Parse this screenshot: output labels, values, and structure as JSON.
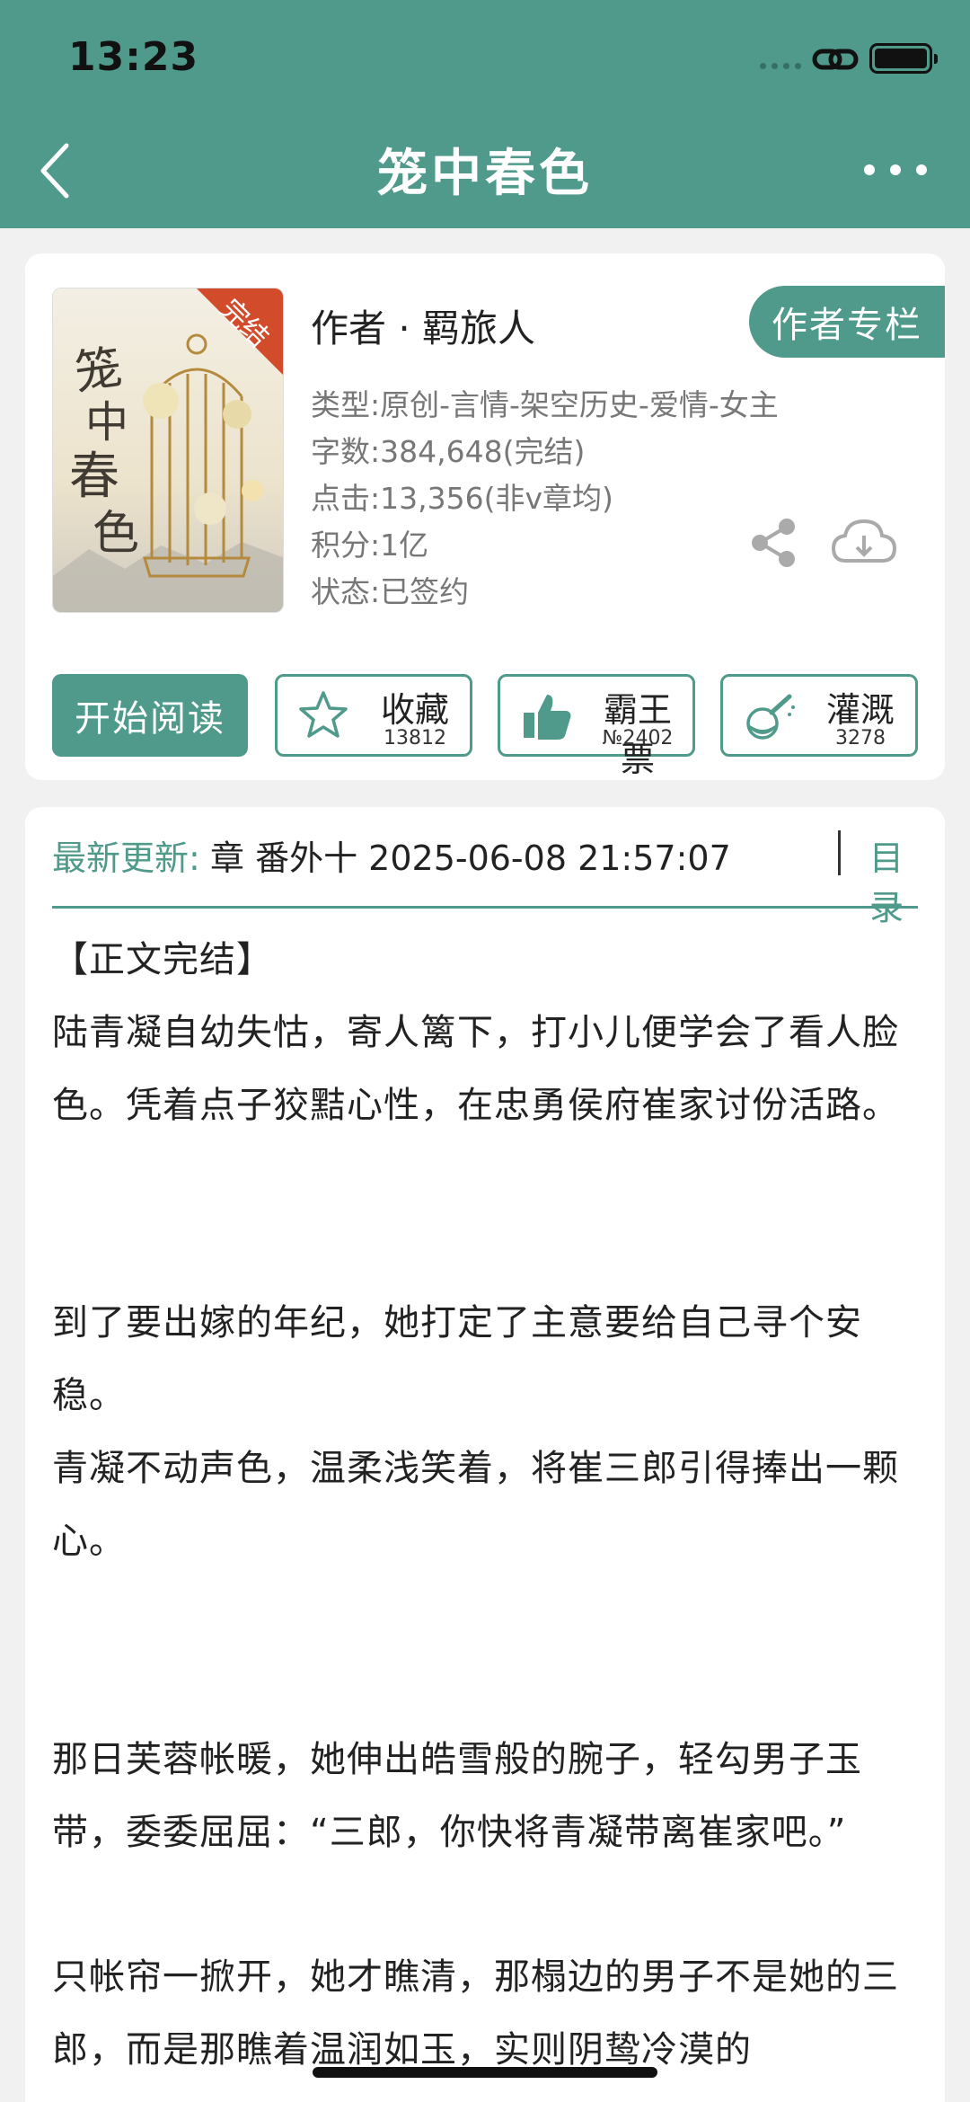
{
  "status_bar": {
    "time": "13:23"
  },
  "header": {
    "title": "笼中春色"
  },
  "book": {
    "cover_text": "笼中春色",
    "cover_badge": "完结",
    "author": "作者 · 羁旅人",
    "author_button": "作者专栏",
    "meta": [
      "类型:原创-言情-架空历史-爱情-女主",
      "字数:384,648(完结)",
      "点击:13,356(非v章均)",
      "积分:1亿",
      "状态:已签约"
    ]
  },
  "actions": {
    "read": "开始阅读",
    "favorite": {
      "label": "收藏",
      "count": "13812"
    },
    "ticket": {
      "label": "霸王票",
      "count": "№2402"
    },
    "water": {
      "label": "灌溉",
      "count": "3278"
    }
  },
  "update": {
    "label": "最新更新:",
    "text": "章 番外十 2025-06-08 21:57:07",
    "toc": "目录"
  },
  "synopsis": [
    "【正文完结】",
    "陆青凝自幼失怙，寄人篱下，打小儿便学会了看人脸色。凭着点子狡黠心性，在忠勇侯府崔家讨份活路。",
    "到了要出嫁的年纪，她打定了主意要给自己寻个安稳。",
    "青凝不动声色，温柔浅笑着，将崔三郎引得捧出一颗心。",
    "那日芙蓉帐暖，她伸出皓雪般的腕子，轻勾男子玉带，委委屈屈：“三郎，你快将青凝带离崔家吧。”",
    "只帐帘一掀开，她才瞧清，那榻边的男子不是她的三郎，而是那瞧着温润如玉，实则阴鸷冷漠的"
  ],
  "colors": {
    "accent": "#4f9a8b"
  }
}
